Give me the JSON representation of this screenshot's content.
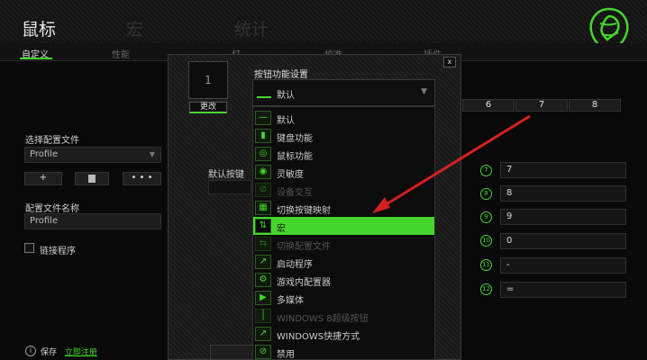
{
  "colors": {
    "accent": "#44d62c",
    "arrow": "#d42020"
  },
  "header": {
    "tabs": [
      {
        "label": "鼠标"
      },
      {
        "label": "宏"
      },
      {
        "label": "统计"
      }
    ],
    "logo_icon": "razer-snake-logo"
  },
  "subnav": {
    "tabs": [
      {
        "label": "自定义"
      },
      {
        "label": "性能"
      },
      {
        "label": "灯"
      },
      {
        "label": "校准"
      },
      {
        "label": "插件"
      }
    ]
  },
  "sidebar": {
    "profile_label": "选择配置文件",
    "profile_value": "Profile",
    "add_button": "+",
    "more_button": "• • •",
    "profile_name_label": "配置文件名称",
    "profile_name_value": "Profile",
    "link_program_label": "链接程序"
  },
  "footer": {
    "save_text": "保存",
    "register_link": "立即注册"
  },
  "number_panel": {
    "tabs": [
      "6",
      "7",
      "8"
    ],
    "rows": [
      {
        "badge": "7",
        "value": "7"
      },
      {
        "badge": "8",
        "value": "8"
      },
      {
        "badge": "9",
        "value": "9"
      },
      {
        "badge": "10",
        "value": "0"
      },
      {
        "badge": "11",
        "value": "-"
      },
      {
        "badge": "12",
        "value": "="
      }
    ]
  },
  "dialog": {
    "close": "x",
    "key_number": "1",
    "change_button": "更改",
    "title": "按钮功能设置",
    "selected_value": "默认",
    "default_key_label": "默认按键",
    "options": [
      {
        "label": "默认",
        "icon": "default-icon",
        "state": "normal"
      },
      {
        "label": "键盘功能",
        "icon": "keyboard-icon",
        "state": "normal"
      },
      {
        "label": "鼠标功能",
        "icon": "mouse-icon",
        "state": "normal"
      },
      {
        "label": "灵敏度",
        "icon": "sensitivity-icon",
        "state": "normal"
      },
      {
        "label": "设备交互",
        "icon": "device-interaction-icon",
        "state": "disabled"
      },
      {
        "label": "切换按键映射",
        "icon": "keymap-toggle-icon",
        "state": "normal"
      },
      {
        "label": "宏",
        "icon": "macro-icon",
        "state": "selected"
      },
      {
        "label": "切换配置文件",
        "icon": "profile-switch-icon",
        "state": "disabled"
      },
      {
        "label": "启动程序",
        "icon": "launch-program-icon",
        "state": "normal"
      },
      {
        "label": "游戏内配置器",
        "icon": "in-game-config-icon",
        "state": "normal"
      },
      {
        "label": "多媒体",
        "icon": "multimedia-icon",
        "state": "normal"
      },
      {
        "label": "WINDOWS 8超级按钮",
        "icon": "windows8-charms-icon",
        "state": "disabled"
      },
      {
        "label": "WINDOWS快捷方式",
        "icon": "windows-shortcut-icon",
        "state": "normal"
      },
      {
        "label": "禁用",
        "icon": "disable-icon",
        "state": "normal"
      }
    ]
  }
}
